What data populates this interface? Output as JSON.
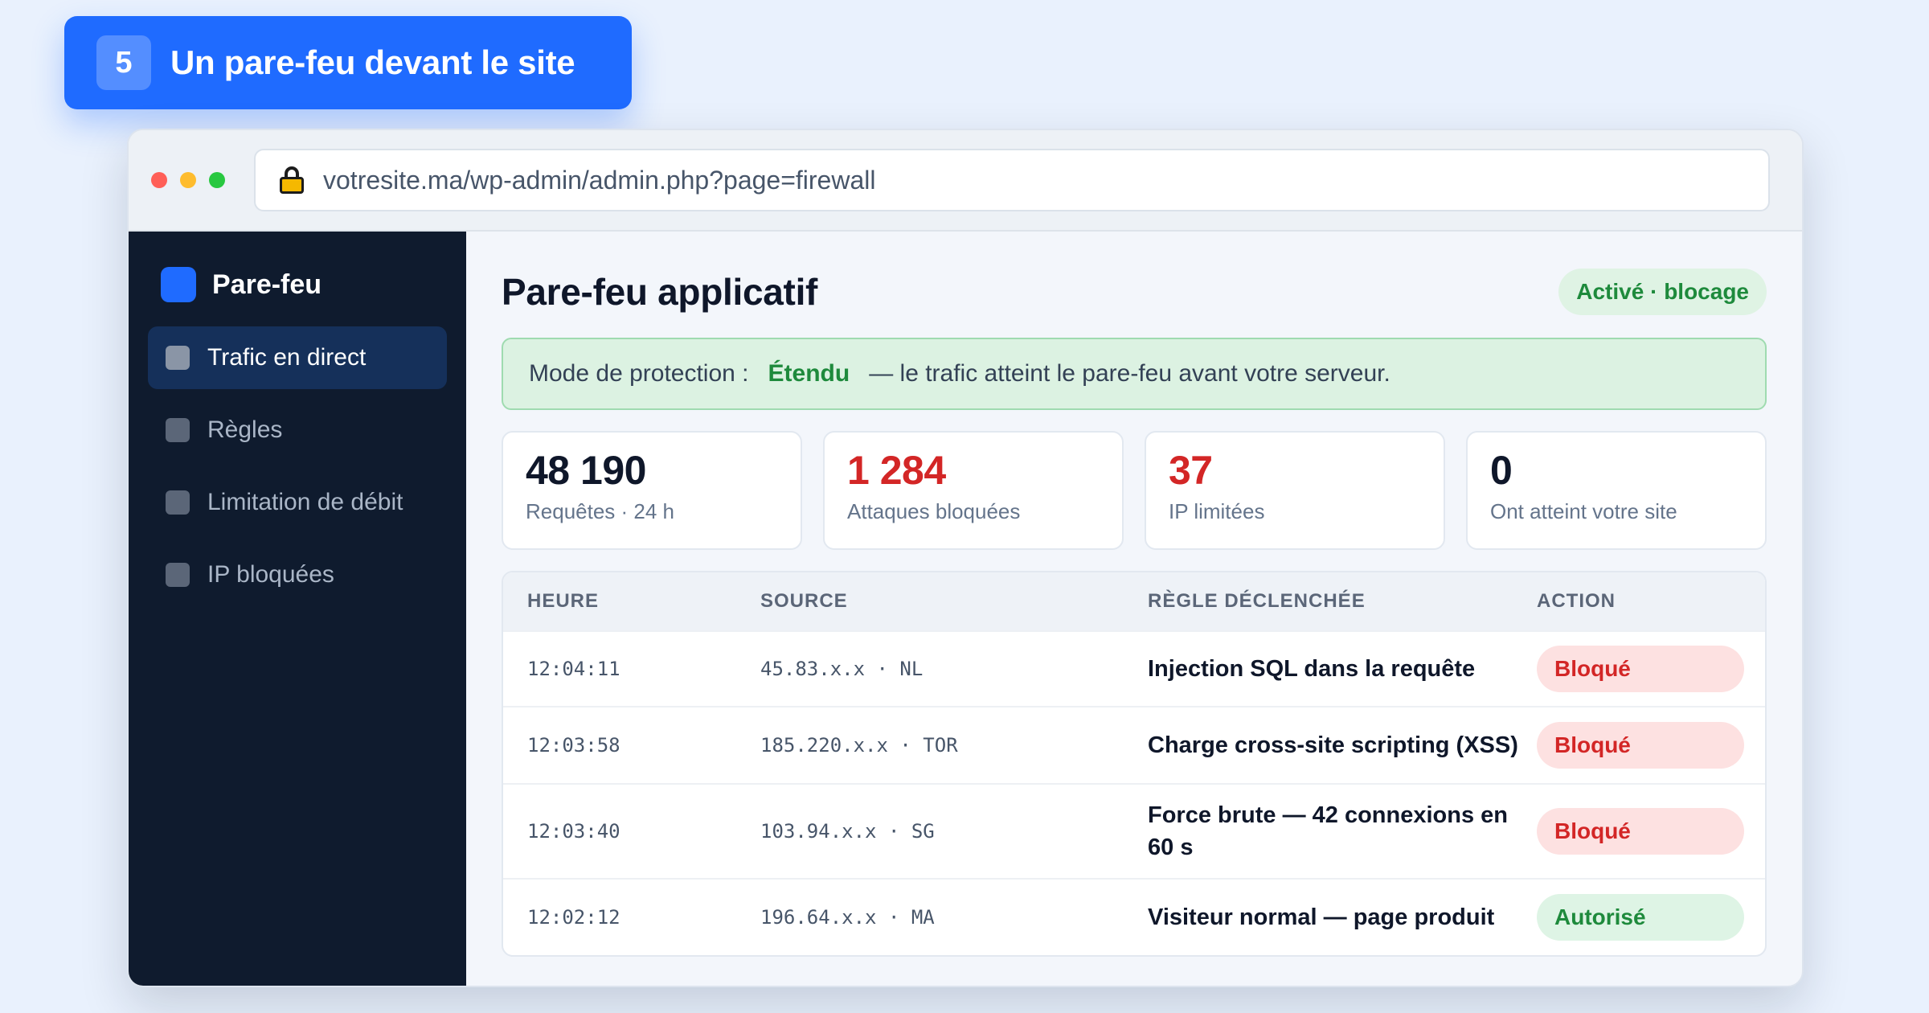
{
  "step": {
    "number": "5",
    "title": "Un pare-feu devant le site"
  },
  "browser": {
    "url": "votresite.ma/wp-admin/admin.php?page=firewall"
  },
  "sidebar": {
    "brand": "Pare-feu",
    "items": [
      {
        "label": "Trafic en direct",
        "active": true
      },
      {
        "label": "Règles",
        "active": false
      },
      {
        "label": "Limitation de débit",
        "active": false
      },
      {
        "label": "IP bloquées",
        "active": false
      }
    ]
  },
  "main": {
    "title": "Pare-feu applicatif",
    "status": "Activé · blocage",
    "mode": {
      "label": "Mode de protection :",
      "value": "Étendu",
      "description": "— le trafic atteint le pare-feu avant votre serveur."
    },
    "stats": [
      {
        "value": "48 190",
        "label": "Requêtes · 24 h"
      },
      {
        "value": "1 284",
        "label": "Attaques bloquées"
      },
      {
        "value": "37",
        "label": "IP limitées"
      },
      {
        "value": "0",
        "label": "Ont atteint votre site"
      }
    ],
    "log": {
      "headers": [
        "HEURE",
        "SOURCE",
        "RÈGLE DÉCLENCHÉE",
        "ACTION"
      ],
      "rows": [
        {
          "time": "12:04:11",
          "source": "45.83.x.x · NL",
          "rule": "Injection SQL dans la requête",
          "action": "Bloqué"
        },
        {
          "time": "12:03:58",
          "source": "185.220.x.x · TOR",
          "rule": "Charge cross-site scripting (XSS)",
          "action": "Bloqué"
        },
        {
          "time": "12:03:40",
          "source": "103.94.x.x · SG",
          "rule": "Force brute — 42 connexions en 60 s",
          "action": "Bloqué"
        },
        {
          "time": "12:02:12",
          "source": "196.64.x.x · MA",
          "rule": "Visiteur normal — page produit",
          "action": "Autorisé"
        }
      ]
    }
  },
  "colors": {
    "accent": "#1f6bff",
    "sidebar_bg": "#0f1b2e",
    "blocked": "#d32626",
    "allowed": "#1e8a3c"
  }
}
